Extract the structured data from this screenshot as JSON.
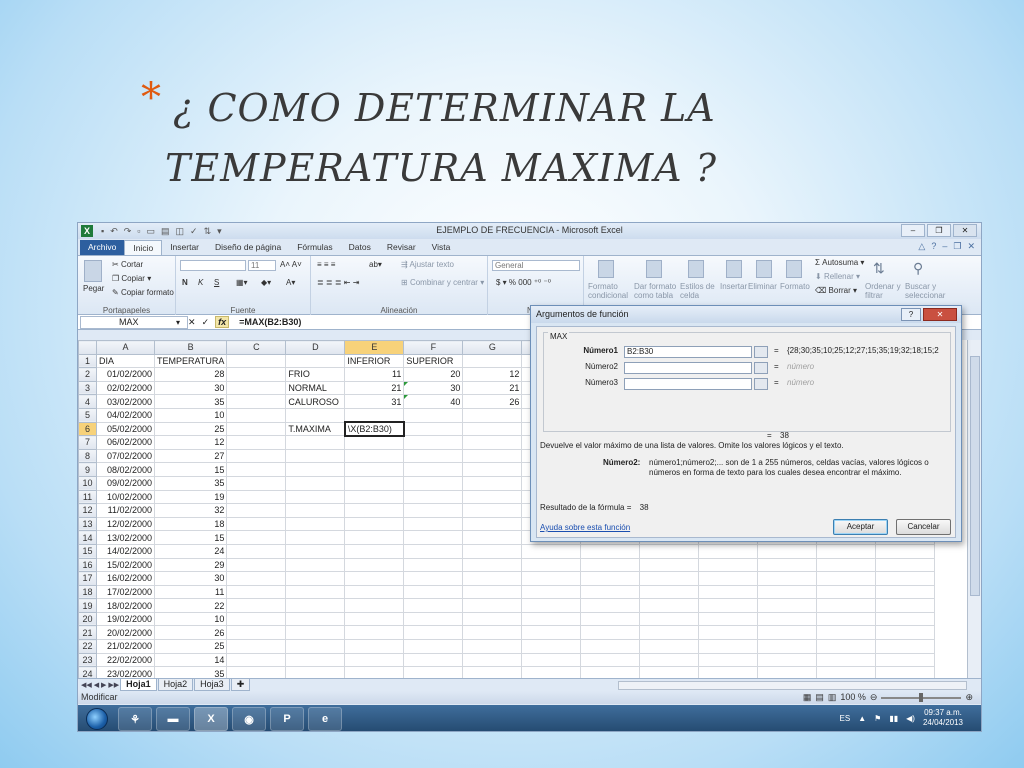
{
  "slide": {
    "bullet": "*",
    "title_line1": "¿ COMO DETERMINAR LA",
    "title_line2": "TEMPERATURA MAXIMA ?"
  },
  "window": {
    "title": "EJEMPLO DE FRECUENCIA - Microsoft Excel",
    "app_icon": "X",
    "min": "–",
    "max": "❐",
    "close": "✕"
  },
  "ribbon_tabs": [
    "Archivo",
    "Inicio",
    "Insertar",
    "Diseño de página",
    "Fórmulas",
    "Datos",
    "Revisar",
    "Vista"
  ],
  "ribbon": {
    "paste": "Pegar",
    "cut": "Cortar",
    "copy": "Copiar",
    "format_painter": "Copiar formato",
    "clipboard_group": "Portapapeles",
    "font_size": "11",
    "bold": "N",
    "italic": "K",
    "underline": "S",
    "font_group": "Fuente",
    "wrap_text": "Ajustar texto",
    "merge_center": "Combinar y centrar",
    "alignment_group": "Alineación",
    "number_format": "General",
    "number_group": "Núm",
    "cond_format": "Formato condicional",
    "format_table": "Dar formato como tabla",
    "cell_styles": "Estilos de celda",
    "insert": "Insertar",
    "delete": "Eliminar",
    "format": "Formato",
    "autosum": "Autosuma",
    "fill": "Rellenar",
    "clear": "Borrar",
    "sort_filter": "Ordenar y filtrar",
    "find_select": "Buscar y seleccionar"
  },
  "formula_bar": {
    "name_box": "MAX",
    "fx": "fx",
    "cancel": "✕",
    "enter": "✓",
    "formula": "=MAX(B2:B30)"
  },
  "columns": [
    "A",
    "B",
    "C",
    "D",
    "E",
    "F",
    "G",
    "H",
    "I",
    "J",
    "K",
    "L",
    "M",
    "N"
  ],
  "rows": [
    [
      "DIA",
      "TEMPERATURA",
      "",
      "",
      "INFERIOR",
      "SUPERIOR",
      ""
    ],
    [
      "01/02/2000",
      "28",
      "",
      "FRIO",
      "11",
      "20",
      "12"
    ],
    [
      "02/02/2000",
      "30",
      "",
      "NORMAL",
      "21",
      "30",
      "21"
    ],
    [
      "03/02/2000",
      "35",
      "",
      "CALUROSO",
      "31",
      "40",
      "26"
    ],
    [
      "04/02/2000",
      "10",
      "",
      "",
      "",
      "",
      ""
    ],
    [
      "05/02/2000",
      "25",
      "",
      "T.MAXIMA",
      "\\X(B2:B30)",
      "",
      ""
    ],
    [
      "06/02/2000",
      "12",
      "",
      "",
      "",
      "",
      ""
    ],
    [
      "07/02/2000",
      "27",
      "",
      "",
      "",
      "",
      ""
    ],
    [
      "08/02/2000",
      "15",
      "",
      "",
      "",
      "",
      ""
    ],
    [
      "09/02/2000",
      "35",
      "",
      "",
      "",
      "",
      ""
    ],
    [
      "10/02/2000",
      "19",
      "",
      "",
      "",
      "",
      ""
    ],
    [
      "11/02/2000",
      "32",
      "",
      "",
      "",
      "",
      ""
    ],
    [
      "12/02/2000",
      "18",
      "",
      "",
      "",
      "",
      ""
    ],
    [
      "13/02/2000",
      "15",
      "",
      "",
      "",
      "",
      ""
    ],
    [
      "14/02/2000",
      "24",
      "",
      "",
      "",
      "",
      ""
    ],
    [
      "15/02/2000",
      "29",
      "",
      "",
      "",
      "",
      ""
    ],
    [
      "16/02/2000",
      "30",
      "",
      "",
      "",
      "",
      ""
    ],
    [
      "17/02/2000",
      "11",
      "",
      "",
      "",
      "",
      ""
    ],
    [
      "18/02/2000",
      "22",
      "",
      "",
      "",
      "",
      ""
    ],
    [
      "19/02/2000",
      "10",
      "",
      "",
      "",
      "",
      ""
    ],
    [
      "20/02/2000",
      "26",
      "",
      "",
      "",
      "",
      ""
    ],
    [
      "21/02/2000",
      "25",
      "",
      "",
      "",
      "",
      ""
    ],
    [
      "22/02/2000",
      "14",
      "",
      "",
      "",
      "",
      ""
    ],
    [
      "23/02/2000",
      "35",
      "",
      "",
      "",
      "",
      ""
    ]
  ],
  "sheets": [
    "Hoja1",
    "Hoja2",
    "Hoja3"
  ],
  "status": {
    "mode": "Modificar",
    "zoom": "100 %"
  },
  "taskbar": {
    "lang": "ES",
    "time": "09:37 a.m.",
    "date": "24/04/2013",
    "apps": [
      "pin-icon",
      "folder-icon",
      "excel-icon",
      "chrome-icon",
      "powerpoint-icon",
      "ie-icon"
    ],
    "excel_letter": "X",
    "powerpoint_letter": "P",
    "ie_letter": "e"
  },
  "dialog": {
    "title": "Argumentos de función",
    "help": "?",
    "close": "✕",
    "function_name": "MAX",
    "args": [
      {
        "label": "Número1",
        "value": "B2:B30",
        "result": "{28;30;35;10;25;12;27;15;35;19;32;18;15;2"
      },
      {
        "label": "Número2",
        "value": "",
        "result": "número"
      },
      {
        "label": "Número3",
        "value": "",
        "result": "número"
      }
    ],
    "equals": "=",
    "result_value": "38",
    "description": "Devuelve el valor máximo de una lista de valores. Omite los valores lógicos y el texto.",
    "arg_desc_label": "Número2:",
    "arg_desc": "número1;número2;... son de 1 a 255 números, celdas vacías, valores lógicos o números en forma de texto para los cuales desea encontrar el máximo.",
    "formula_result_label": "Resultado de la fórmula =",
    "formula_result_value": "38",
    "help_link": "Ayuda sobre esta función",
    "ok": "Aceptar",
    "cancel": "Cancelar"
  }
}
